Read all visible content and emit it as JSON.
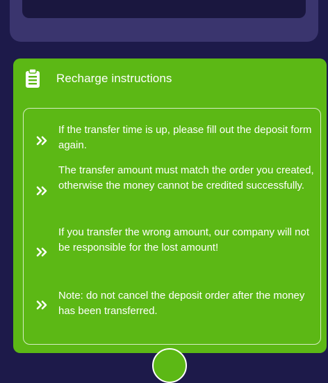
{
  "colors": {
    "page_background": "#1d1a4a",
    "card_background": "#3a356e",
    "panel_green": "#5cb815",
    "text": "#ffffff"
  },
  "instructions": {
    "icon": "clipboard-list-icon",
    "title": "Recharge instructions",
    "items": [
      {
        "icon": "double-chevron-right-icon",
        "text": "If the transfer time is up, please fill out the deposit form again."
      },
      {
        "icon": "double-chevron-right-icon",
        "text": "The transfer amount must match the order you created, otherwise the money cannot be credited successfully."
      },
      {
        "icon": "double-chevron-right-icon",
        "text": "If you transfer the wrong amount, our company will not be responsible for the lost amount!"
      },
      {
        "icon": "double-chevron-right-icon",
        "text": "Note: do not cancel the deposit order after the money has been transferred."
      }
    ]
  }
}
